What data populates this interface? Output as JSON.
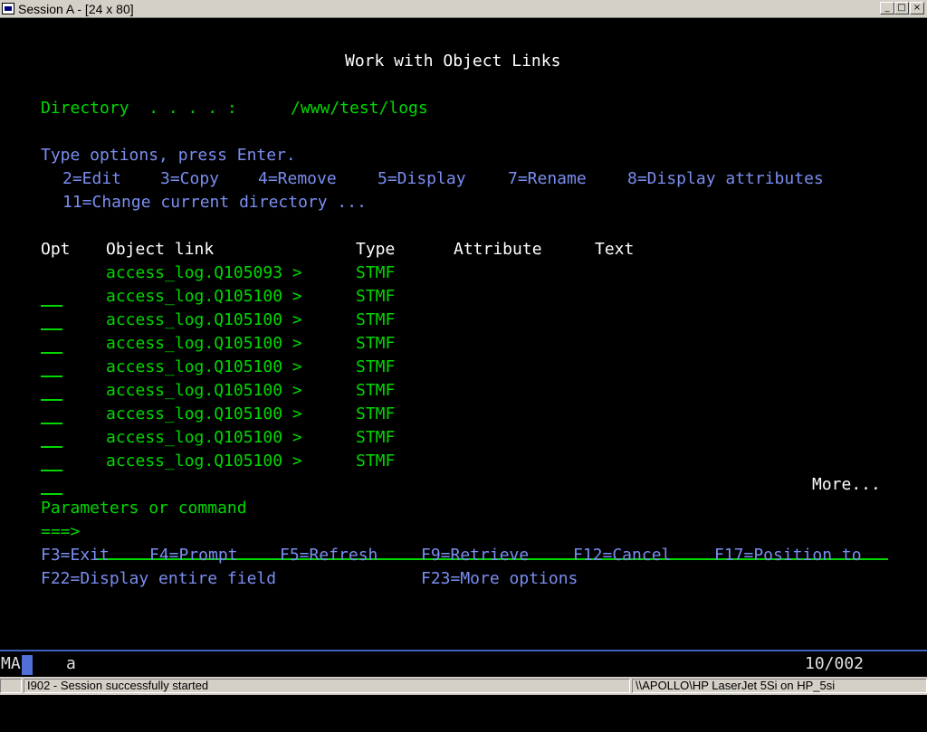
{
  "window": {
    "title": "Session A - [24 x 80]",
    "min": "_",
    "max": "□",
    "close": "×"
  },
  "screen": {
    "title": "Work with Object Links",
    "directory_label": "Directory  . . . . :",
    "directory_value": "/www/test/logs",
    "instruction": "Type options, press Enter.",
    "options": [
      "2=Edit",
      "3=Copy",
      "4=Remove",
      "5=Display",
      "7=Rename",
      "8=Display attributes",
      "11=Change current directory ..."
    ],
    "columns": {
      "opt": "Opt",
      "object_link": "Object link",
      "type": "Type",
      "attribute": "Attribute",
      "text": "Text"
    },
    "rows": [
      {
        "object_link": "access_log.Q105093 >",
        "type": "STMF"
      },
      {
        "object_link": "access_log.Q105100 >",
        "type": "STMF"
      },
      {
        "object_link": "access_log.Q105100 >",
        "type": "STMF"
      },
      {
        "object_link": "access_log.Q105100 >",
        "type": "STMF"
      },
      {
        "object_link": "access_log.Q105100 >",
        "type": "STMF"
      },
      {
        "object_link": "access_log.Q105100 >",
        "type": "STMF"
      },
      {
        "object_link": "access_log.Q105100 >",
        "type": "STMF"
      },
      {
        "object_link": "access_log.Q105100 >",
        "type": "STMF"
      },
      {
        "object_link": "access_log.Q105100 >",
        "type": "STMF"
      }
    ],
    "more": "More...",
    "params_label": "Parameters or command",
    "prompt": "===>",
    "fkeys": [
      "F3=Exit",
      "F4=Prompt",
      "F5=Refresh",
      "F9=Retrieve",
      "F12=Cancel",
      "F17=Position to",
      "F22=Display entire field",
      "F23=More options"
    ]
  },
  "status": {
    "indicator": "MA",
    "mode": "a",
    "position": "10/002"
  },
  "bottombar": {
    "message": "I902 - Session successfully started",
    "printer": "\\\\APOLLO\\HP LaserJet 5Si on HP_5si"
  },
  "colors": {
    "green": "#00d800",
    "blue": "#7a8ef0",
    "white": "#ffffff",
    "status_accent": "#5070d8"
  }
}
